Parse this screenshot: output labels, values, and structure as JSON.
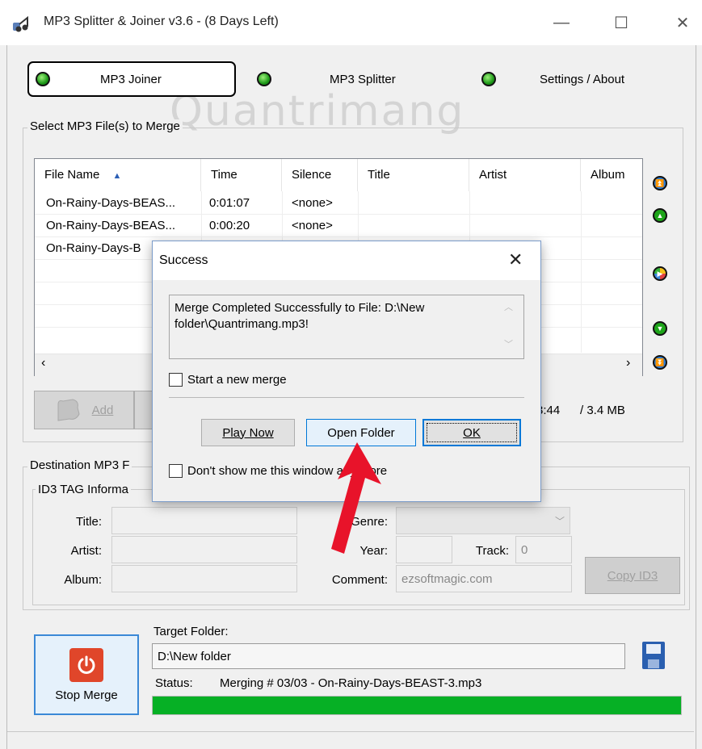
{
  "window": {
    "title": "MP3 Splitter & Joiner v3.6 - (8 Days Left)",
    "controls": {
      "minimize": "—",
      "maximize": "☐",
      "close": "✕"
    }
  },
  "watermark": "Quantrimang",
  "nav": {
    "tabs": [
      {
        "label": "MP3 Joiner",
        "active": true
      },
      {
        "label": "MP3 Splitter",
        "active": false
      },
      {
        "label": "Settings / About",
        "active": false
      }
    ]
  },
  "merge_group": {
    "label": "Select MP3 File(s) to Merge",
    "columns": [
      "File Name",
      "Time",
      "Silence",
      "Title",
      "Artist",
      "Album"
    ],
    "rows": [
      {
        "file": "On-Rainy-Days-BEAS...",
        "time": "0:01:07",
        "silence": "<none>"
      },
      {
        "file": "On-Rainy-Days-BEAS...",
        "time": "0:00:20",
        "silence": "<none>"
      },
      {
        "file": "On-Rainy-Days-B",
        "time": "",
        "silence": ""
      }
    ],
    "side_icons": [
      "move-top-icon",
      "move-up-icon",
      "play-icon",
      "move-down-icon",
      "move-bottom-icon"
    ],
    "add_button": "Add",
    "total_time": "3:44",
    "total_size": "/  3.4 MB"
  },
  "destination_group": {
    "label": "Destination MP3 F",
    "id3_label": "ID3 TAG Informa",
    "fields": {
      "title_label": "Title:",
      "artist_label": "Artist:",
      "album_label": "Album:",
      "genre_label": "Genre:",
      "year_label": "Year:",
      "track_label": "Track:",
      "track_value": "0",
      "comment_label": "Comment:",
      "comment_value": "ezsoftmagic.com"
    },
    "copy_id3_button": "Copy ID3"
  },
  "bottom": {
    "stop_button": "Stop Merge",
    "target_label": "Target Folder:",
    "target_value": "D:\\New folder",
    "status_label": "Status:",
    "status_value": "Merging # 03/03 - On-Rainy-Days-BEAST-3.mp3",
    "progress": 1.0
  },
  "dialog": {
    "title": "Success",
    "message": "Merge Completed Successfully to File: D:\\New folder\\Quantrimang.mp3!",
    "checkbox_new_merge": "Start a new merge",
    "buttons": {
      "play": "Play Now",
      "open": "Open Folder",
      "ok": "OK"
    },
    "checkbox_dont_show": "Don't show me this window any more"
  },
  "colors": {
    "accent_blue": "#3a88d6",
    "progress_green": "#06b025",
    "stop_red": "#e0462a",
    "annotation_arrow": "#e8132a"
  }
}
